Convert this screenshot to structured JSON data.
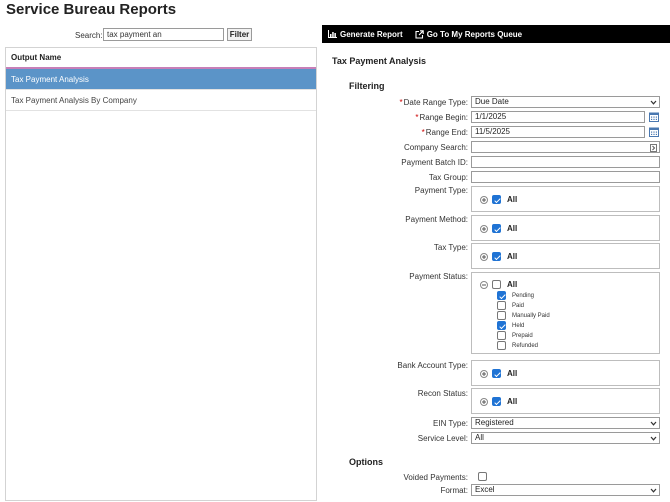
{
  "page": {
    "title": "Service Bureau Reports"
  },
  "search": {
    "label": "Search:",
    "value": "tax payment an",
    "filter_label": "Filter"
  },
  "output": {
    "header": "Output Name",
    "items": [
      {
        "label": "Tax Payment Analysis",
        "selected": true
      },
      {
        "label": "Tax Payment Analysis By Company",
        "selected": false
      }
    ]
  },
  "toolbar": {
    "generate_label": "Generate Report",
    "queue_label": "Go To My Reports Queue"
  },
  "report": {
    "title": "Tax Payment Analysis"
  },
  "filtering": {
    "heading": "Filtering",
    "date_range_type": {
      "label": "Date Range Type:",
      "value": "Due Date"
    },
    "range_begin": {
      "label": "Range Begin:",
      "value": "1/1/2025"
    },
    "range_end": {
      "label": "Range End:",
      "value": "11/5/2025"
    },
    "company_search": {
      "label": "Company Search:",
      "value": ""
    },
    "payment_batch_id": {
      "label": "Payment Batch ID:",
      "value": ""
    },
    "tax_group": {
      "label": "Tax Group:",
      "value": ""
    },
    "payment_type": {
      "label": "Payment Type:",
      "all_label": "All",
      "all_checked": true
    },
    "payment_method": {
      "label": "Payment Method:",
      "all_label": "All",
      "all_checked": true
    },
    "tax_type": {
      "label": "Tax Type:",
      "all_label": "All",
      "all_checked": true
    },
    "payment_status": {
      "label": "Payment Status:",
      "all_label": "All",
      "all_checked": false,
      "options": [
        {
          "label": "Pending",
          "checked": true
        },
        {
          "label": "Paid",
          "checked": false
        },
        {
          "label": "Manually Paid",
          "checked": false
        },
        {
          "label": "Held",
          "checked": true
        },
        {
          "label": "Prepaid",
          "checked": false
        },
        {
          "label": "Refunded",
          "checked": false
        }
      ]
    },
    "bank_account_type": {
      "label": "Bank Account Type:",
      "all_label": "All",
      "all_checked": true
    },
    "recon_status": {
      "label": "Recon Status:",
      "all_label": "All",
      "all_checked": true
    },
    "ein_type": {
      "label": "EIN Type:",
      "value": "Registered"
    },
    "service_level": {
      "label": "Service Level:",
      "value": "All"
    }
  },
  "options": {
    "heading": "Options",
    "voided_payments": {
      "label": "Voided Payments:",
      "checked": false
    },
    "format": {
      "label": "Format:",
      "value": "Excel"
    }
  },
  "colors": {
    "selected_row": "#5b94c8",
    "checkbox_on": "#1f73d4",
    "header_underline": "#c77fb8"
  }
}
